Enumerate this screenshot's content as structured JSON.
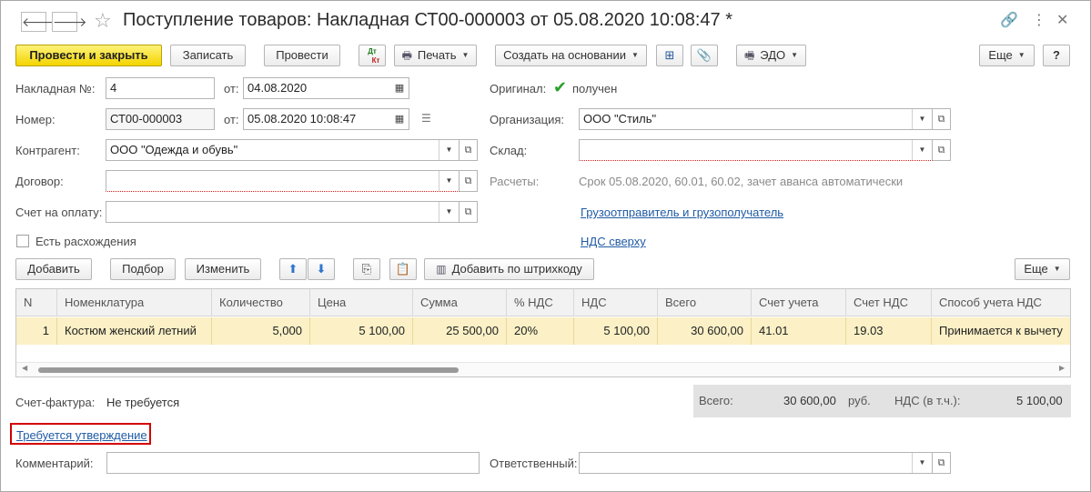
{
  "window": {
    "title": "Поступление товаров: Накладная СТ00-000003 от 05.08.2020 10:08:47 *",
    "back_icon": "arrow-left-icon",
    "forward_icon": "arrow-right-icon",
    "favorite_icon": "star-icon",
    "link_icon": "link-icon",
    "more_icon": "vertical-dots-icon",
    "close_icon": "close-icon"
  },
  "toolbar": {
    "post_close": "Провести и закрыть",
    "save": "Записать",
    "post": "Провести",
    "dt_kt_top": "Дт",
    "dt_kt_bottom": "Кт",
    "print": "Печать",
    "create_based": "Создать на основании",
    "edo": "ЭДО",
    "more": "Еще",
    "help": "?"
  },
  "form": {
    "invoice_no_label": "Накладная №:",
    "invoice_no_value": "4",
    "from_label": "от:",
    "invoice_date": "04.08.2020",
    "number_label": "Номер:",
    "number_value": "СТ00-000003",
    "from_label2": "от:",
    "doc_datetime": "05.08.2020 10:08:47",
    "original_label": "Оригинал:",
    "original_value": "получен",
    "organization_label": "Организация:",
    "organization_value": "ООО \"Стиль\"",
    "counterparty_label": "Контрагент:",
    "counterparty_value": "ООО \"Одежда и обувь\"",
    "warehouse_label": "Склад:",
    "warehouse_value": "",
    "contract_label": "Договор:",
    "contract_value": "",
    "settlements_label": "Расчеты:",
    "settlements_value": "Срок 05.08.2020, 60.01, 60.02, зачет аванса автоматически",
    "payment_invoice_label": "Счет на оплату:",
    "payment_invoice_value": "",
    "shipper_link": "Грузоотправитель и грузополучатель",
    "discrepancy_label": "Есть расхождения",
    "vat_link": "НДС сверху"
  },
  "table_toolbar": {
    "add": "Добавить",
    "select": "Подбор",
    "edit": "Изменить",
    "add_barcode": "Добавить по штрихкоду",
    "more": "Еще"
  },
  "table": {
    "headers": [
      "N",
      "Номенклатура",
      "Количество",
      "Цена",
      "Сумма",
      "% НДС",
      "НДС",
      "Всего",
      "Счет учета",
      "Счет НДС",
      "Способ учета НДС"
    ],
    "rows": [
      [
        "1",
        "Костюм женский летний",
        "5,000",
        "5 100,00",
        "25 500,00",
        "20%",
        "5 100,00",
        "30 600,00",
        "41.01",
        "19.03",
        "Принимается к вычету"
      ]
    ]
  },
  "footer": {
    "invoice_label": "Счет-фактура:",
    "invoice_value": "Не требуется",
    "total_label": "Всего:",
    "total_value": "30 600,00",
    "currency": "руб.",
    "vat_label": "НДС (в т.ч.):",
    "vat_value": "5 100,00",
    "approval_link": "Требуется утверждение",
    "comment_label": "Комментарий:",
    "comment_value": "",
    "responsible_label": "Ответственный:",
    "responsible_value": ""
  }
}
